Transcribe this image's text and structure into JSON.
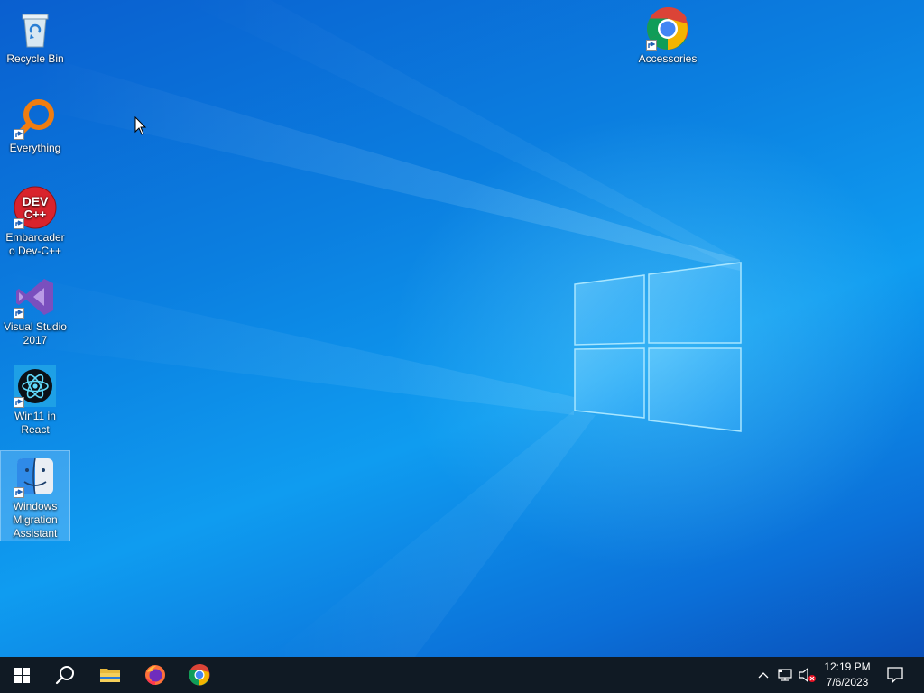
{
  "desktop": {
    "icons": [
      {
        "label": "Recycle Bin",
        "icon": "recycle-bin-icon"
      },
      {
        "label": "Everything",
        "icon": "everything-search-icon"
      },
      {
        "label": "Embarcadero Dev-C++",
        "icon": "dev-cpp-icon",
        "badge": "DEV C++"
      },
      {
        "label": "Visual Studio 2017",
        "icon": "visual-studio-icon"
      },
      {
        "label": "Win11 in React",
        "icon": "react-icon"
      },
      {
        "label": "Windows Migration Assistant",
        "icon": "migration-assistant-icon",
        "selected": true
      },
      {
        "label": "Accessories",
        "icon": "chrome-icon"
      }
    ]
  },
  "taskbar": {
    "pinned": [
      {
        "name": "start",
        "icon": "windows-logo-icon"
      },
      {
        "name": "search",
        "icon": "search-icon"
      },
      {
        "name": "file-explorer",
        "icon": "folder-icon"
      },
      {
        "name": "firefox",
        "icon": "firefox-icon"
      },
      {
        "name": "chrome",
        "icon": "chrome-icon"
      }
    ],
    "tray": {
      "icons": [
        "chevron-up-icon",
        "network-icon",
        "volume-muted-icon"
      ],
      "time": "12:19 PM",
      "date": "7/6/2023"
    }
  },
  "colors": {
    "taskbar": "#101a24",
    "desktop_accent": "#0b7fe0"
  }
}
